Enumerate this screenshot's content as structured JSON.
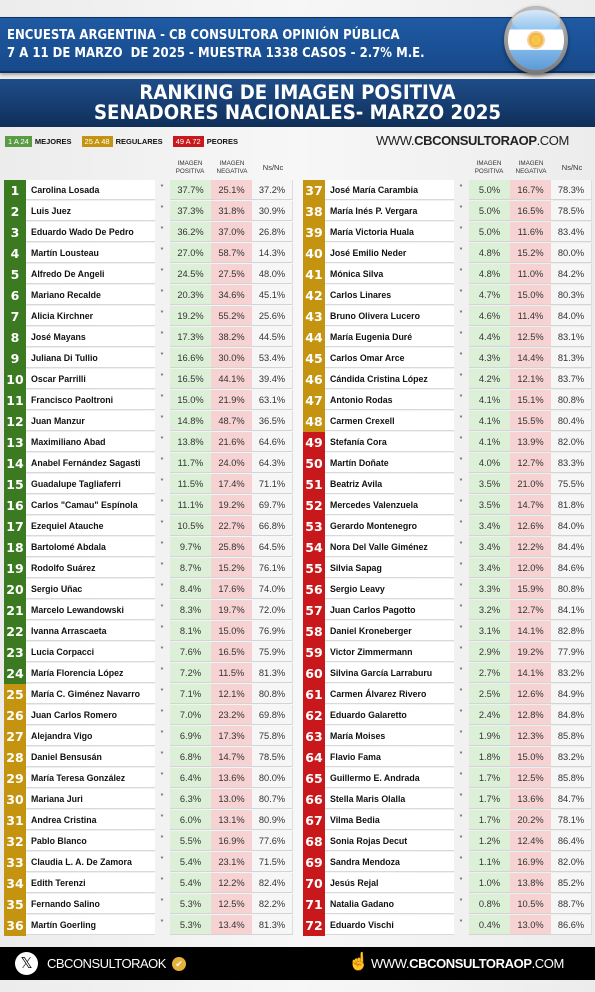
{
  "header": {
    "line1": "ENCUESTA ARGENTINA - CB CONSULTORA OPINIÓN PÚBLICA",
    "line2": "7 A 11 DE MARZO  DE 2025 - MUESTRA 1338 CASOS - 2.7% M.E.",
    "flag_icon": "argentina-flag-icon"
  },
  "title": {
    "line1": "RANKING DE IMAGEN POSITIVA",
    "line2": "SENADORES NACIONALES- MARZO 2025"
  },
  "legend": [
    {
      "range": "1 A 24",
      "label": "MEJORES",
      "color": "#5a9c45"
    },
    {
      "range": "25 A 48",
      "label": "REGULARES",
      "color": "#c49410"
    },
    {
      "range": "49 A 72",
      "label": "PEORES",
      "color": "#c8181b"
    }
  ],
  "website": {
    "prefix": "WWW.",
    "brand": "CBCONSULTORAOP",
    "suffix": ".COM"
  },
  "columns": {
    "positive": "IMAGEN POSITIVA",
    "negative": "IMAGEN NEGATIVA",
    "nsnc": "Ns/Nc"
  },
  "tiers": {
    "green": "#3c7a22",
    "gold": "#c49410",
    "red": "#c8181b"
  },
  "senators": [
    {
      "rank": "1",
      "name": "Carolina Losada",
      "mark": "*",
      "positive": "37.7%",
      "negative": "25.1%",
      "nsnc": "37.2%",
      "tier": "green"
    },
    {
      "rank": "2",
      "name": "Luis Juez",
      "mark": "*",
      "positive": "37.3%",
      "negative": "31.8%",
      "nsnc": "30.9%",
      "tier": "green"
    },
    {
      "rank": "3",
      "name": "Eduardo Wado De Pedro",
      "mark": "*",
      "positive": "36.2%",
      "negative": "37.0%",
      "nsnc": "26.8%",
      "tier": "green"
    },
    {
      "rank": "4",
      "name": "Martín Lousteau",
      "mark": "*",
      "positive": "27.0%",
      "negative": "58.7%",
      "nsnc": "14.3%",
      "tier": "green"
    },
    {
      "rank": "5",
      "name": "Alfredo De Angeli",
      "mark": "*",
      "positive": "24.5%",
      "negative": "27.5%",
      "nsnc": "48.0%",
      "tier": "green"
    },
    {
      "rank": "6",
      "name": "Mariano Recalde",
      "mark": "*",
      "positive": "20.3%",
      "negative": "34.6%",
      "nsnc": "45.1%",
      "tier": "green"
    },
    {
      "rank": "7",
      "name": "Alicia Kirchner",
      "mark": "*",
      "positive": "19.2%",
      "negative": "55.2%",
      "nsnc": "25.6%",
      "tier": "green"
    },
    {
      "rank": "8",
      "name": "José Mayans",
      "mark": "*",
      "positive": "17.3%",
      "negative": "38.2%",
      "nsnc": "44.5%",
      "tier": "green"
    },
    {
      "rank": "9",
      "name": "Juliana Di Tullio",
      "mark": "*",
      "positive": "16.6%",
      "negative": "30.0%",
      "nsnc": "53.4%",
      "tier": "green"
    },
    {
      "rank": "10",
      "name": "Oscar Parrilli",
      "mark": "*",
      "positive": "16.5%",
      "negative": "44.1%",
      "nsnc": "39.4%",
      "tier": "green"
    },
    {
      "rank": "11",
      "name": "Francisco Paoltroni",
      "mark": "*",
      "positive": "15.0%",
      "negative": "21.9%",
      "nsnc": "63.1%",
      "tier": "green"
    },
    {
      "rank": "12",
      "name": "Juan Manzur",
      "mark": "*",
      "positive": "14.8%",
      "negative": "48.7%",
      "nsnc": "36.5%",
      "tier": "green"
    },
    {
      "rank": "13",
      "name": "Maximiliano Abad",
      "mark": "*",
      "positive": "13.8%",
      "negative": "21.6%",
      "nsnc": "64.6%",
      "tier": "green"
    },
    {
      "rank": "14",
      "name": "Anabel Fernández Sagasti",
      "mark": "*",
      "positive": "11.7%",
      "negative": "24.0%",
      "nsnc": "64.3%",
      "tier": "green"
    },
    {
      "rank": "15",
      "name": "Guadalupe Tagliaferri",
      "mark": "*",
      "positive": "11.5%",
      "negative": "17.4%",
      "nsnc": "71.1%",
      "tier": "green"
    },
    {
      "rank": "16",
      "name": "Carlos \"Camau\" Espínola",
      "mark": "*",
      "positive": "11.1%",
      "negative": "19.2%",
      "nsnc": "69.7%",
      "tier": "green"
    },
    {
      "rank": "17",
      "name": "Ezequiel Atauche",
      "mark": "*",
      "positive": "10.5%",
      "negative": "22.7%",
      "nsnc": "66.8%",
      "tier": "green"
    },
    {
      "rank": "18",
      "name": "Bartolomé Abdala",
      "mark": "*",
      "positive": "9.7%",
      "negative": "25.8%",
      "nsnc": "64.5%",
      "tier": "green"
    },
    {
      "rank": "19",
      "name": "Rodolfo Suárez",
      "mark": "*",
      "positive": "8.7%",
      "negative": "15.2%",
      "nsnc": "76.1%",
      "tier": "green"
    },
    {
      "rank": "20",
      "name": "Sergio Uñac",
      "mark": "*",
      "positive": "8.4%",
      "negative": "17.6%",
      "nsnc": "74.0%",
      "tier": "green"
    },
    {
      "rank": "21",
      "name": "Marcelo Lewandowski",
      "mark": "*",
      "positive": "8.3%",
      "negative": "19.7%",
      "nsnc": "72.0%",
      "tier": "green"
    },
    {
      "rank": "22",
      "name": "Ivanna Arrascaeta",
      "mark": "*",
      "positive": "8.1%",
      "negative": "15.0%",
      "nsnc": "76.9%",
      "tier": "green"
    },
    {
      "rank": "23",
      "name": "Lucia Corpacci",
      "mark": "*",
      "positive": "7.6%",
      "negative": "16.5%",
      "nsnc": "75.9%",
      "tier": "green"
    },
    {
      "rank": "24",
      "name": "María Florencia López",
      "mark": "*",
      "positive": "7.2%",
      "negative": "11.5%",
      "nsnc": "81.3%",
      "tier": "green"
    },
    {
      "rank": "25",
      "name": "María C. Giménez Navarro",
      "mark": "*",
      "positive": "7.1%",
      "negative": "12.1%",
      "nsnc": "80.8%",
      "tier": "gold"
    },
    {
      "rank": "26",
      "name": "Juan Carlos Romero",
      "mark": "*",
      "positive": "7.0%",
      "negative": "23.2%",
      "nsnc": "69.8%",
      "tier": "gold"
    },
    {
      "rank": "27",
      "name": "Alejandra Vigo",
      "mark": "*",
      "positive": "6.9%",
      "negative": "17.3%",
      "nsnc": "75.8%",
      "tier": "gold"
    },
    {
      "rank": "28",
      "name": "Daniel Bensusán",
      "mark": "*",
      "positive": "6.8%",
      "negative": "14.7%",
      "nsnc": "78.5%",
      "tier": "gold"
    },
    {
      "rank": "29",
      "name": "María Teresa González",
      "mark": "*",
      "positive": "6.4%",
      "negative": "13.6%",
      "nsnc": "80.0%",
      "tier": "gold"
    },
    {
      "rank": "30",
      "name": "Mariana Juri",
      "mark": "*",
      "positive": "6.3%",
      "negative": "13.0%",
      "nsnc": "80.7%",
      "tier": "gold"
    },
    {
      "rank": "31",
      "name": "Andrea Cristina",
      "mark": "*",
      "positive": "6.0%",
      "negative": "13.1%",
      "nsnc": "80.9%",
      "tier": "gold"
    },
    {
      "rank": "32",
      "name": "Pablo Blanco",
      "mark": "*",
      "positive": "5.5%",
      "negative": "16.9%",
      "nsnc": "77.6%",
      "tier": "gold"
    },
    {
      "rank": "33",
      "name": "Claudia L. A. De Zamora",
      "mark": "*",
      "positive": "5.4%",
      "negative": "23.1%",
      "nsnc": "71.5%",
      "tier": "gold"
    },
    {
      "rank": "34",
      "name": "Edith Terenzi",
      "mark": "*",
      "positive": "5.4%",
      "negative": "12.2%",
      "nsnc": "82.4%",
      "tier": "gold"
    },
    {
      "rank": "35",
      "name": "Fernando Salino",
      "mark": "*",
      "positive": "5.3%",
      "negative": "12.5%",
      "nsnc": "82.2%",
      "tier": "gold"
    },
    {
      "rank": "36",
      "name": "Martín Goerling",
      "mark": "*",
      "positive": "5.3%",
      "negative": "13.4%",
      "nsnc": "81.3%",
      "tier": "gold"
    },
    {
      "rank": "37",
      "name": "José María Carambia",
      "mark": "*",
      "positive": "5.0%",
      "negative": "16.7%",
      "nsnc": "78.3%",
      "tier": "gold"
    },
    {
      "rank": "38",
      "name": "María Inés P. Vergara",
      "mark": "*",
      "positive": "5.0%",
      "negative": "16.5%",
      "nsnc": "78.5%",
      "tier": "gold"
    },
    {
      "rank": "39",
      "name": "María Victoria Huala",
      "mark": "*",
      "positive": "5.0%",
      "negative": "11.6%",
      "nsnc": "83.4%",
      "tier": "gold"
    },
    {
      "rank": "40",
      "name": "José Emilio Neder",
      "mark": "*",
      "positive": "4.8%",
      "negative": "15.2%",
      "nsnc": "80.0%",
      "tier": "gold"
    },
    {
      "rank": "41",
      "name": "Mónica Silva",
      "mark": "*",
      "positive": "4.8%",
      "negative": "11.0%",
      "nsnc": "84.2%",
      "tier": "gold"
    },
    {
      "rank": "42",
      "name": "Carlos Linares",
      "mark": "*",
      "positive": "4.7%",
      "negative": "15.0%",
      "nsnc": "80.3%",
      "tier": "gold"
    },
    {
      "rank": "43",
      "name": "Bruno Olivera Lucero",
      "mark": "*",
      "positive": "4.6%",
      "negative": "11.4%",
      "nsnc": "84.0%",
      "tier": "gold"
    },
    {
      "rank": "44",
      "name": "María Eugenia Duré",
      "mark": "*",
      "positive": "4.4%",
      "negative": "12.5%",
      "nsnc": "83.1%",
      "tier": "gold"
    },
    {
      "rank": "45",
      "name": "Carlos Omar Arce",
      "mark": "*",
      "positive": "4.3%",
      "negative": "14.4%",
      "nsnc": "81.3%",
      "tier": "gold"
    },
    {
      "rank": "46",
      "name": "Cándida Cristina López",
      "mark": "*",
      "positive": "4.2%",
      "negative": "12.1%",
      "nsnc": "83.7%",
      "tier": "gold"
    },
    {
      "rank": "47",
      "name": "Antonio Rodas",
      "mark": "*",
      "positive": "4.1%",
      "negative": "15.1%",
      "nsnc": "80.8%",
      "tier": "gold"
    },
    {
      "rank": "48",
      "name": "Carmen Crexell",
      "mark": "*",
      "positive": "4.1%",
      "negative": "15.5%",
      "nsnc": "80.4%",
      "tier": "gold"
    },
    {
      "rank": "49",
      "name": "Stefanía Cora",
      "mark": "*",
      "positive": "4.1%",
      "negative": "13.9%",
      "nsnc": "82.0%",
      "tier": "red"
    },
    {
      "rank": "50",
      "name": "Martín Doñate",
      "mark": "*",
      "positive": "4.0%",
      "negative": "12.7%",
      "nsnc": "83.3%",
      "tier": "red"
    },
    {
      "rank": "51",
      "name": "Beatriz Avila",
      "mark": "*",
      "positive": "3.5%",
      "negative": "21.0%",
      "nsnc": "75.5%",
      "tier": "red"
    },
    {
      "rank": "52",
      "name": "Mercedes Valenzuela",
      "mark": "*",
      "positive": "3.5%",
      "negative": "14.7%",
      "nsnc": "81.8%",
      "tier": "red"
    },
    {
      "rank": "53",
      "name": "Gerardo Montenegro",
      "mark": "*",
      "positive": "3.4%",
      "negative": "12.6%",
      "nsnc": "84.0%",
      "tier": "red"
    },
    {
      "rank": "54",
      "name": "Nora Del Valle Giménez",
      "mark": "*",
      "positive": "3.4%",
      "negative": "12.2%",
      "nsnc": "84.4%",
      "tier": "red"
    },
    {
      "rank": "55",
      "name": "Silvia Sapag",
      "mark": "*",
      "positive": "3.4%",
      "negative": "12.0%",
      "nsnc": "84.6%",
      "tier": "red"
    },
    {
      "rank": "56",
      "name": "Sergio Leavy",
      "mark": "*",
      "positive": "3.3%",
      "negative": "15.9%",
      "nsnc": "80.8%",
      "tier": "red"
    },
    {
      "rank": "57",
      "name": "Juan Carlos Pagotto",
      "mark": "*",
      "positive": "3.2%",
      "negative": "12.7%",
      "nsnc": "84.1%",
      "tier": "red"
    },
    {
      "rank": "58",
      "name": "Daniel Kroneberger",
      "mark": "*",
      "positive": "3.1%",
      "negative": "14.1%",
      "nsnc": "82.8%",
      "tier": "red"
    },
    {
      "rank": "59",
      "name": "Victor Zimmermann",
      "mark": "*",
      "positive": "2.9%",
      "negative": "19.2%",
      "nsnc": "77.9%",
      "tier": "red"
    },
    {
      "rank": "60",
      "name": "Silvina García Larraburu",
      "mark": "*",
      "positive": "2.7%",
      "negative": "14.1%",
      "nsnc": "83.2%",
      "tier": "red"
    },
    {
      "rank": "61",
      "name": "Carmen Álvarez Rivero",
      "mark": "*",
      "positive": "2.5%",
      "negative": "12.6%",
      "nsnc": "84.9%",
      "tier": "red"
    },
    {
      "rank": "62",
      "name": "Eduardo Galaretto",
      "mark": "*",
      "positive": "2.4%",
      "negative": "12.8%",
      "nsnc": "84.8%",
      "tier": "red"
    },
    {
      "rank": "63",
      "name": "María Moises",
      "mark": "*",
      "positive": "1.9%",
      "negative": "12.3%",
      "nsnc": "85.8%",
      "tier": "red"
    },
    {
      "rank": "64",
      "name": "Flavio Fama",
      "mark": "*",
      "positive": "1.8%",
      "negative": "15.0%",
      "nsnc": "83.2%",
      "tier": "red"
    },
    {
      "rank": "65",
      "name": "Guillermo E. Andrada",
      "mark": "*",
      "positive": "1.7%",
      "negative": "12.5%",
      "nsnc": "85.8%",
      "tier": "red"
    },
    {
      "rank": "66",
      "name": "Stella Maris Olalla",
      "mark": "*",
      "positive": "1.7%",
      "negative": "13.6%",
      "nsnc": "84.7%",
      "tier": "red"
    },
    {
      "rank": "67",
      "name": "Vilma Bedia",
      "mark": "*",
      "positive": "1.7%",
      "negative": "20.2%",
      "nsnc": "78.1%",
      "tier": "red"
    },
    {
      "rank": "68",
      "name": "Sonia Rojas Decut",
      "mark": "*",
      "positive": "1.2%",
      "negative": "12.4%",
      "nsnc": "86.4%",
      "tier": "red"
    },
    {
      "rank": "69",
      "name": "Sandra Mendoza",
      "mark": "*",
      "positive": "1.1%",
      "negative": "16.9%",
      "nsnc": "82.0%",
      "tier": "red"
    },
    {
      "rank": "70",
      "name": "Jesús Rejal",
      "mark": "*",
      "positive": "1.0%",
      "negative": "13.8%",
      "nsnc": "85.2%",
      "tier": "red"
    },
    {
      "rank": "71",
      "name": "Natalia Gadano",
      "mark": "*",
      "positive": "0.8%",
      "negative": "10.5%",
      "nsnc": "88.7%",
      "tier": "red"
    },
    {
      "rank": "72",
      "name": "Eduardo Vischi",
      "mark": "*",
      "positive": "0.4%",
      "negative": "13.0%",
      "nsnc": "86.6%",
      "tier": "red"
    }
  ],
  "footer": {
    "x_icon": "𝕏",
    "handle": "CBCONSULTORAOK",
    "verified_icon": "✔",
    "hand_icon": "☝",
    "site_prefix": "WWW.",
    "site_brand": "CBCONSULTORAOP",
    "site_suffix": ".COM"
  }
}
